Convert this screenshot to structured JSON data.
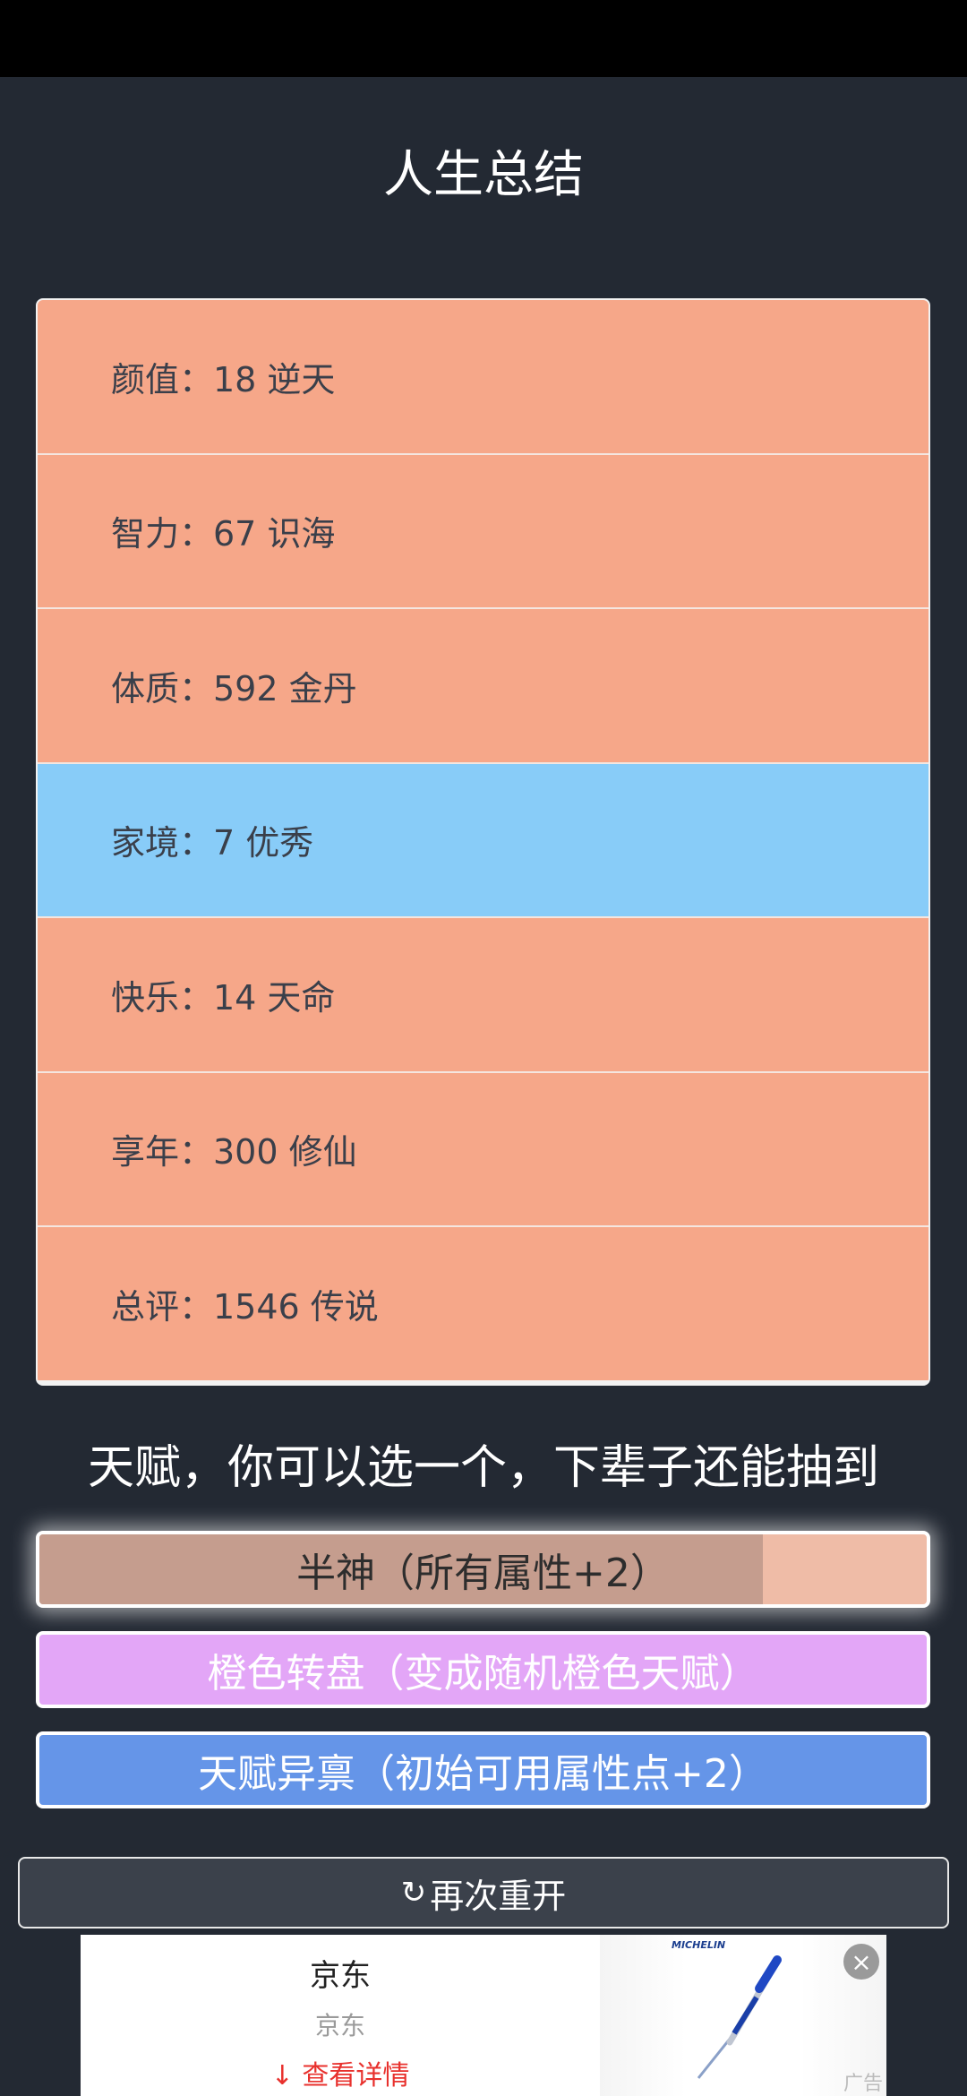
{
  "page": {
    "title": "人生总结"
  },
  "summary": {
    "rows": [
      {
        "text": "颜值：18 逆天",
        "color": "#f6a789"
      },
      {
        "text": "智力：67 识海",
        "color": "#f6a789"
      },
      {
        "text": "体质：592 金丹",
        "color": "#f6a789"
      },
      {
        "text": "家境：7 优秀",
        "color": "#88ccf8"
      },
      {
        "text": "快乐：14 天命",
        "color": "#f6a789"
      },
      {
        "text": "享年：300 修仙",
        "color": "#f6a789"
      },
      {
        "text": "总评：1546 传说",
        "color": "#f6a789"
      }
    ]
  },
  "talents": {
    "heading": "天赋，你可以选一个，下辈子还能抽到",
    "items": [
      {
        "label": "半神（所有属性+2）",
        "color": "#efbca7",
        "selected": true,
        "progress": 0.815
      },
      {
        "label": "橙色转盘（变成随机橙色天赋）",
        "color": "#e3a6f7"
      },
      {
        "label": "天赋异禀（初始可用属性点+2）",
        "color": "#6595e8"
      }
    ]
  },
  "restart": {
    "icon": "refresh-icon",
    "label": "再次重开"
  },
  "ad": {
    "brand": "京东",
    "subtitle": "京东",
    "cta": "查看详情",
    "cta_icon": "download-arrow-icon",
    "logo_text": "MICHELIN",
    "close_icon": "close-icon",
    "tag": "广告"
  }
}
